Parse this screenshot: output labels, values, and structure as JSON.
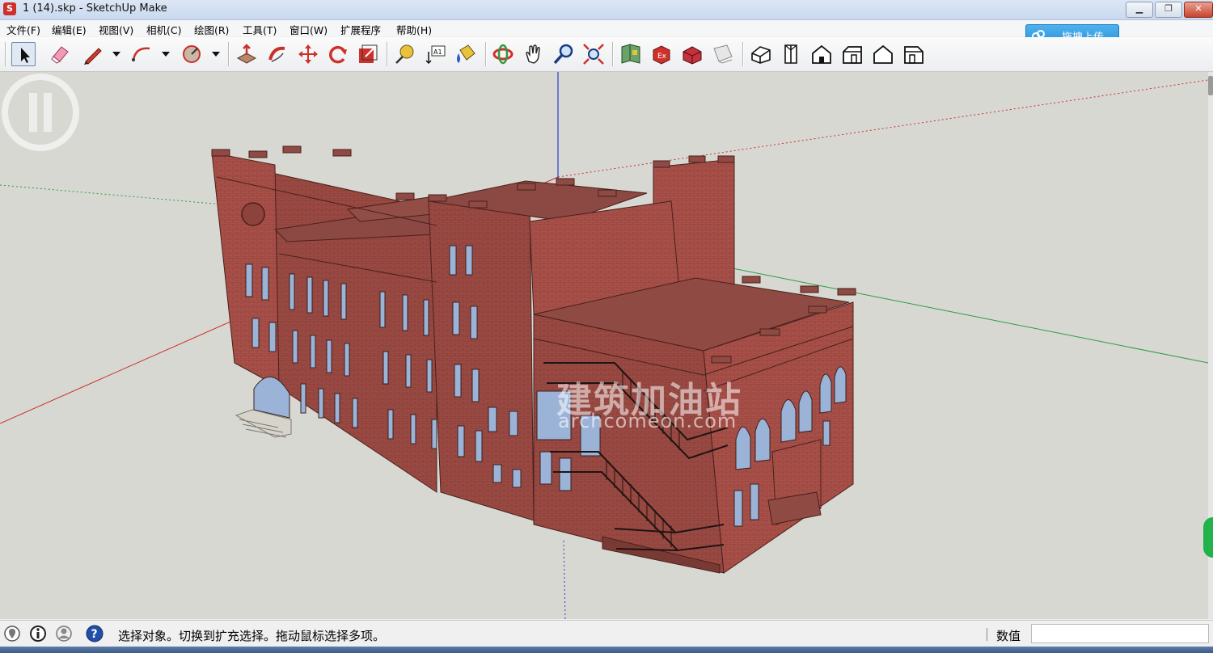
{
  "window": {
    "title": "1 (14).skp - SketchUp Make",
    "app_icon": "sketchup-logo-icon",
    "controls": [
      "minimize-icon",
      "maximize-icon",
      "close-icon"
    ]
  },
  "menu": {
    "items": [
      "文件(F)",
      "编辑(E)",
      "视图(V)",
      "相机(C)",
      "绘图(R)",
      "工具(T)",
      "窗口(W)",
      "扩展程序",
      "帮助(H)"
    ]
  },
  "upload": {
    "label": "拖拽上传",
    "icon": "cloud-upload-icon"
  },
  "toolbar": {
    "tools": [
      "select-icon",
      "eraser-icon",
      "pencil-line-icon",
      "arc-icon",
      "shapes-icon",
      "push-pull-icon",
      "follow-me-icon",
      "move-icon",
      "rotate-icon",
      "scale-icon",
      "tape-measure-icon",
      "text-label-icon",
      "paint-bucket-icon",
      "orbit-icon",
      "pan-icon",
      "zoom-icon",
      "zoom-extents-icon",
      "3d-warehouse-icon",
      "extension-warehouse-icon",
      "share-model-icon",
      "layout-icon",
      "iso-view-icon",
      "top-view-icon",
      "front-view-icon",
      "right-view-icon",
      "back-view-icon",
      "left-view-icon"
    ]
  },
  "watermark": {
    "title": "建筑加油站",
    "url": "archcomeon.com"
  },
  "status": {
    "icons": [
      "geo-location-icon",
      "credits-info-icon",
      "user-account-icon",
      "help-icon"
    ],
    "message": "选择对象。切换到扩充选择。拖动鼠标选择多项。",
    "measurements_label": "数值",
    "measurements_value": ""
  },
  "colors": {
    "viewport_bg": "#d8d8d3",
    "brick": "#9a4a43",
    "brick_dark": "#6f2f2a",
    "glass": "#9cb3d8",
    "axis_red": "#c8302c",
    "axis_green": "#2e9b3d",
    "axis_blue": "#2a3dc8"
  }
}
